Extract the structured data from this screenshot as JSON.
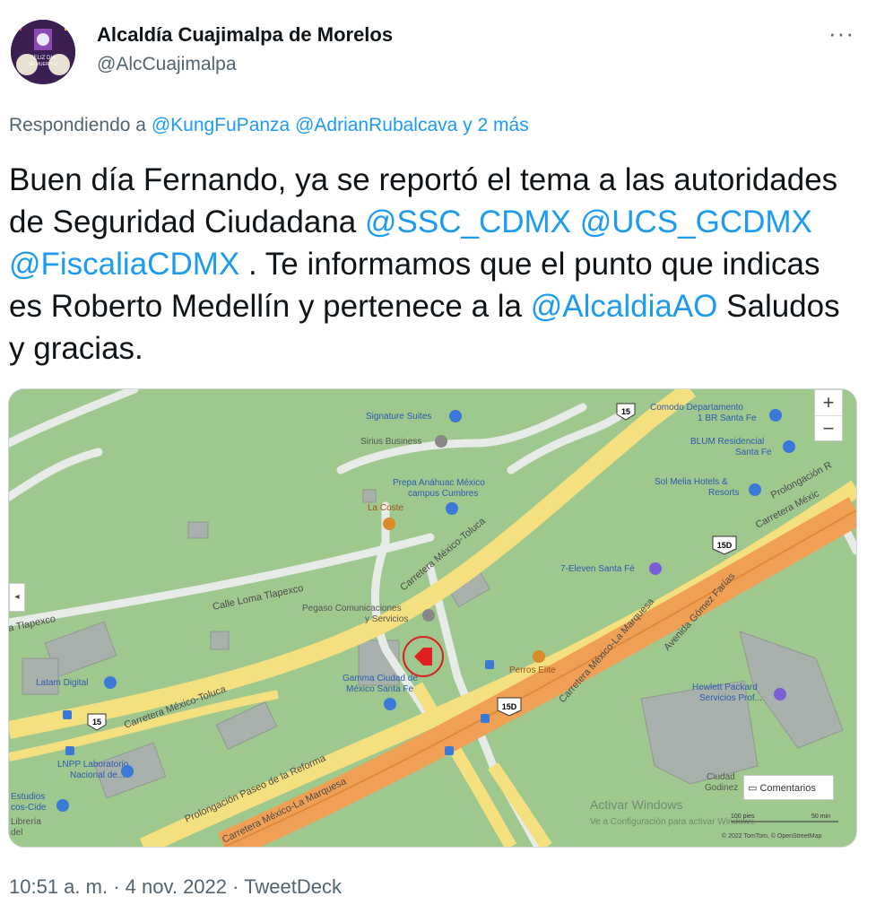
{
  "author": {
    "name": "Alcaldía Cuajimalpa de Morelos",
    "handle": "@AlcCuajimalpa",
    "avatar_text_1": "FELIZ DIA",
    "avatar_text_2": "DE MUERTOS"
  },
  "more_label": "···",
  "reply": {
    "prefix": "Respondiendo a",
    "mention1": "@KungFuPanza",
    "mention2": "@AdrianRubalcava",
    "suffix": "y 2 más"
  },
  "tweet": {
    "part1": "Buen día Fernando, ya se reportó el tema a las autoridades de Seguridad Ciudadana ",
    "mention_ssc": "@SSC_CDMX",
    "mention_ucs": "@UCS_GCDMX",
    "mention_fiscalia": "@FiscaliaCDMX",
    "part2": " . Te informamos que el punto que indicas es Roberto Medellín y pertenece a la ",
    "mention_ao": "@AlcaldiaAO",
    "part3": " Saludos y gracias."
  },
  "map": {
    "zoom_in": "+",
    "zoom_out": "−",
    "collapse": "◂",
    "comments_label": "Comentarios",
    "places": {
      "signature": "Signature Suites",
      "sirius": "Sirius Business",
      "prepa1": "Prepa Anáhuac México",
      "prepa2": "campus Cumbres",
      "lacoste": "La Coste",
      "comodo1": "Comodo Departamento",
      "comodo2": "1 BR Santa Fe",
      "blum1": "BLUM Residencial",
      "blum2": "Santa Fe",
      "solmelia1": "Sol Melia Hotels &",
      "solmelia2": "Resorts",
      "seven": "7-Eleven Santa Fé",
      "pegaso1": "Pegaso Comunicaciones",
      "pegaso2": "y Servicios",
      "gamma1": "Gamma Ciudad de",
      "gamma2": "México Santa Fe",
      "perros": "Perros Elite",
      "latam": "Latam Digital",
      "hp1": "Hewlett Packard",
      "hp2": "Servicios Prof...",
      "lnpp1": "LNPP Laboratorio",
      "lnpp2": "Nacional de...",
      "estudios1": "Estudios",
      "estudios2": "cos-Cide",
      "libreria1": "Librería",
      "libreria2": "del",
      "ciudad1": "Ciudad",
      "ciudad2": "Godinez"
    },
    "roads": {
      "carretera_toluca": "Carretera México-Toluca",
      "carretera_toluca2": "Carretera México-Toluca",
      "loma": "Calle Loma Tlapexco",
      "tlapexco": "a Tlapexco",
      "reforma": "Prolongación Paseo de la Reforma",
      "marquesa1": "Carretera México-La Marquesa",
      "marquesa2": "Carretera México-La Marquesa",
      "gomez": "Avenida Gómez Farías",
      "prolongacion": "Prolongación R",
      "carretera_mexico": "Carretera Méxic",
      "shield15": "15",
      "shield15d": "15D"
    },
    "watermark1": "Activar Windows",
    "watermark2": "Ve a Configuración para activar Windows.",
    "scale_ft": "100 pies",
    "scale_m": "50 min",
    "attribution": "© 2022 TomTom, © OpenStreetMap"
  },
  "footer": {
    "time": "10:51 a. m.",
    "sep": "·",
    "date": "4 nov. 2022",
    "source": "TweetDeck"
  },
  "colors": {
    "link": "#1d9bf0",
    "secondary_text": "#536471",
    "map_green": "#9bc58a",
    "road_yellow": "#f7e58a",
    "highway_orange": "#f2a25a",
    "poi_blue": "#2a7de1",
    "marker_red": "#e02020"
  }
}
